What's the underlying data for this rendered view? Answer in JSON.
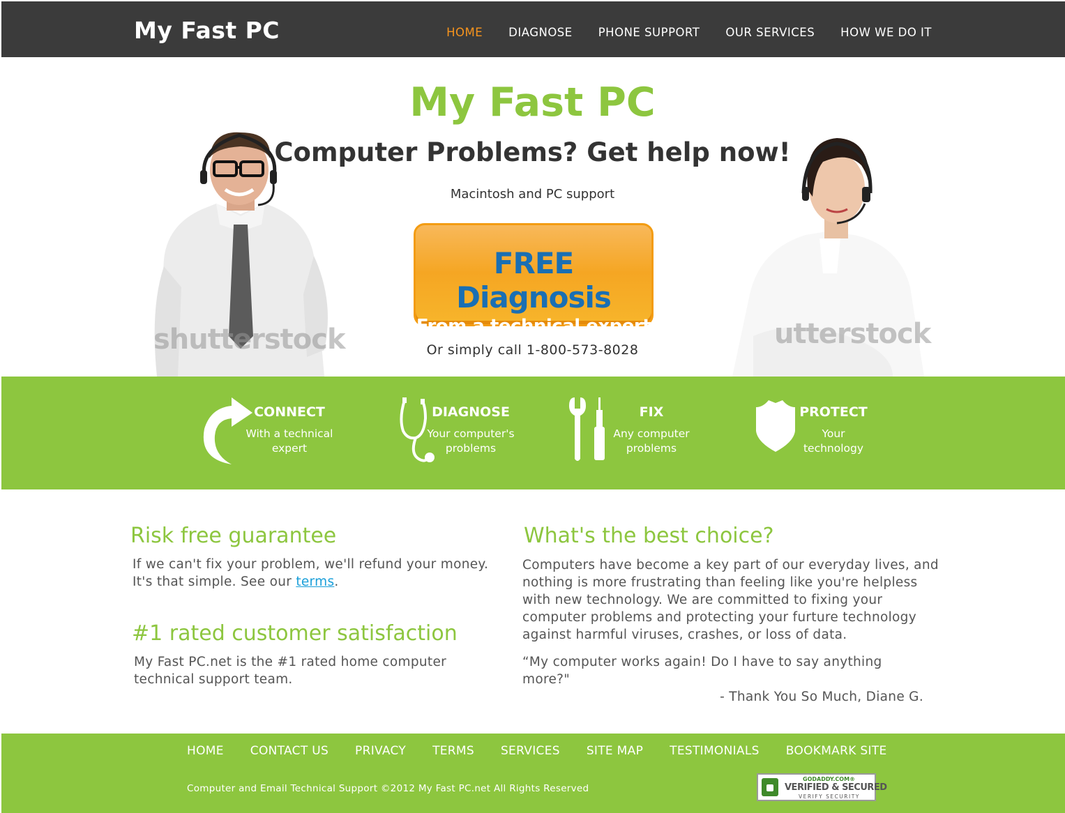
{
  "header": {
    "logo": "My Fast PC",
    "nav": [
      {
        "label": "HOME",
        "active": true
      },
      {
        "label": "DIAGNOSE",
        "active": false
      },
      {
        "label": "PHONE SUPPORT",
        "active": false
      },
      {
        "label": "OUR SERVICES",
        "active": false
      },
      {
        "label": "HOW WE DO IT",
        "active": false
      }
    ],
    "active_color": "#f7941d"
  },
  "hero": {
    "title": "My Fast PC",
    "subtitle": "Computer Problems? Get help now!",
    "tagline": "Macintosh and PC support",
    "cta_main": "FREE Diagnosis",
    "cta_sub": "From a technical expert",
    "call_text": "Or simply call 1-800-573-8028",
    "watermark": "shutterstock"
  },
  "features": [
    {
      "icon": "curved-arrow-icon",
      "title": "CONNECT",
      "desc_line1": "With a technical",
      "desc_line2": "expert"
    },
    {
      "icon": "stethoscope-icon",
      "title": "DIAGNOSE",
      "desc_line1": "Your computer's",
      "desc_line2": "problems"
    },
    {
      "icon": "wrench-screwdriver-icon",
      "title": "FIX",
      "desc_line1": "Any computer",
      "desc_line2": "problems"
    },
    {
      "icon": "shield-icon",
      "title": "PROTECT",
      "desc_line1": "Your",
      "desc_line2": "technology"
    }
  ],
  "content": {
    "guarantee": {
      "title": "Risk free guarantee",
      "line1": "If we can't fix your problem, we'll refund your money.",
      "line2_prefix": "It's that simple. See our ",
      "link": "terms",
      "line2_suffix": "."
    },
    "rated": {
      "title": "#1 rated customer satisfaction",
      "line1": "My Fast PC.net is the #1 rated home computer",
      "line2": "technical support team."
    },
    "choice": {
      "title": "What's the best choice?",
      "lines": [
        "Computers have become a key part of our everyday lives, and",
        "nothing is more frustrating than feeling like you're helpless",
        "with new technology. We are committed to fixing your",
        "computer problems and protecting your furture technology",
        "against harmful viruses, crashes, or loss of data."
      ],
      "quote": "“My computer works again! Do I have to say anything more?\"",
      "attribution": "- Thank You So Much, Diane G."
    }
  },
  "footer": {
    "links": [
      "HOME",
      "CONTACT US",
      "PRIVACY",
      "TERMS",
      "SERVICES",
      "SITE MAP",
      "TESTIMONIALS",
      "BOOKMARK SITE"
    ],
    "copyright": "Computer and Email Technical Support ©2012 My Fast PC.net All Rights Reserved",
    "seal_top": "GODADDY.COM®",
    "seal_mid": "VERIFIED & SECURED",
    "seal_bot": "VERIFY SECURITY"
  },
  "colors": {
    "header_bg": "#3b3b3b",
    "brand_green": "#8dc63f",
    "cta_orange": "#f5a623",
    "cta_blue": "#1a6fb3",
    "link_blue": "#1a9fd9"
  }
}
